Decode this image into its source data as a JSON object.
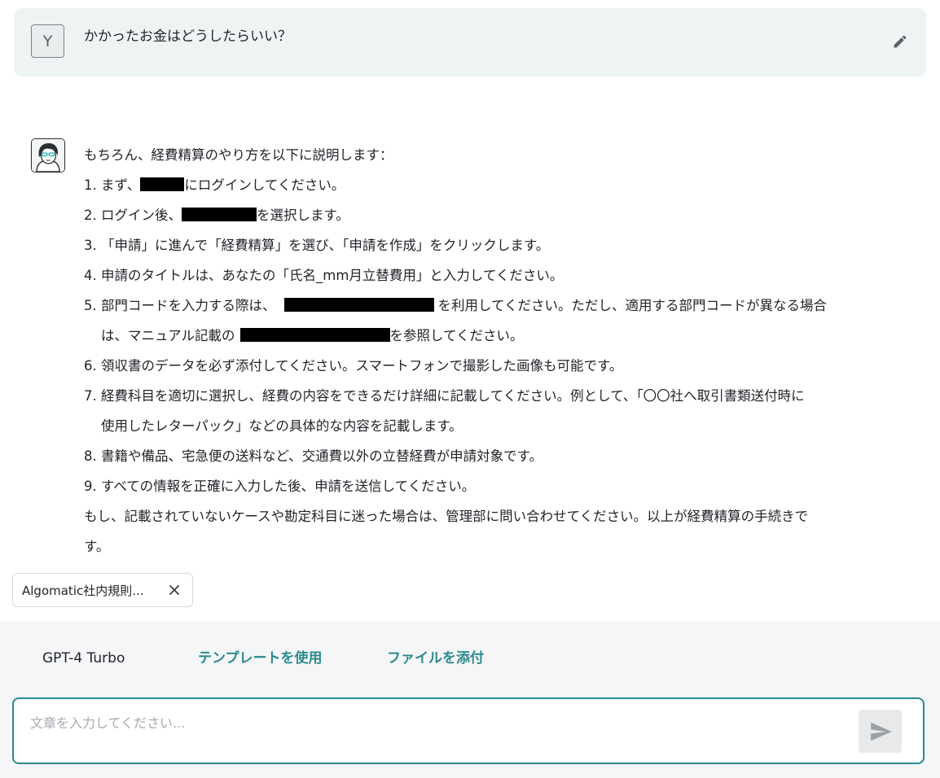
{
  "user_message": {
    "avatar_initial": "Y",
    "text": "かかったお金はどうしたらいい？"
  },
  "assistant_message": {
    "intro": "もちろん、経費精算のやり方を以下に説明します：",
    "items": [
      {
        "num": "1.",
        "a": "まず、",
        "b": "にログインしてください。"
      },
      {
        "num": "2.",
        "a": "ログイン後、",
        "b": "を選択します。"
      },
      {
        "num": "3.",
        "text": "「申請」に進んで「経費精算」を選び、「申請を作成」をクリックします。"
      },
      {
        "num": "4.",
        "text": "申請のタイトルは、あなたの「氏名_mm月立替費用」と入力してください。"
      },
      {
        "num": "5.",
        "a": "部門コードを入力する際は、",
        "b": "を利用してください。ただし、適用する部門コードが異なる場合",
        "c": "は、マニュアル記載の",
        "d": "を参照してください。"
      },
      {
        "num": "6.",
        "text": "領収書のデータを必ず添付してください。スマートフォンで撮影した画像も可能です。"
      },
      {
        "num": "7.",
        "text": "経費科目を適切に選択し、経費の内容をできるだけ詳細に記載してください。例として、「〇〇社へ取引書類送付時に",
        "text2": "使用したレターパック」などの具体的な内容を記載します。"
      },
      {
        "num": "8.",
        "text": "書籍や備品、宅急便の送料など、交通費以外の立替経費が申請対象です。"
      },
      {
        "num": "9.",
        "text": "すべての情報を正確に入力した後、申請を送信してください。"
      }
    ],
    "closing_1": "もし、記載されていないケースや勘定科目に迷った場合は、管理部に問い合わせてください。以上が経費精算の手続きで",
    "closing_2": "す。"
  },
  "attachment": {
    "label": "Algomatic社内規則..."
  },
  "toolbar": {
    "model": "GPT-4 Turbo",
    "template_label": "テンプレートを使用",
    "file_label": "ファイルを添付"
  },
  "input": {
    "placeholder": "文章を入力してください...",
    "value": ""
  },
  "colors": {
    "accent": "#2b8a8e",
    "user_bubble": "#eef3f3",
    "bottom_bar": "#f5f6f7"
  }
}
